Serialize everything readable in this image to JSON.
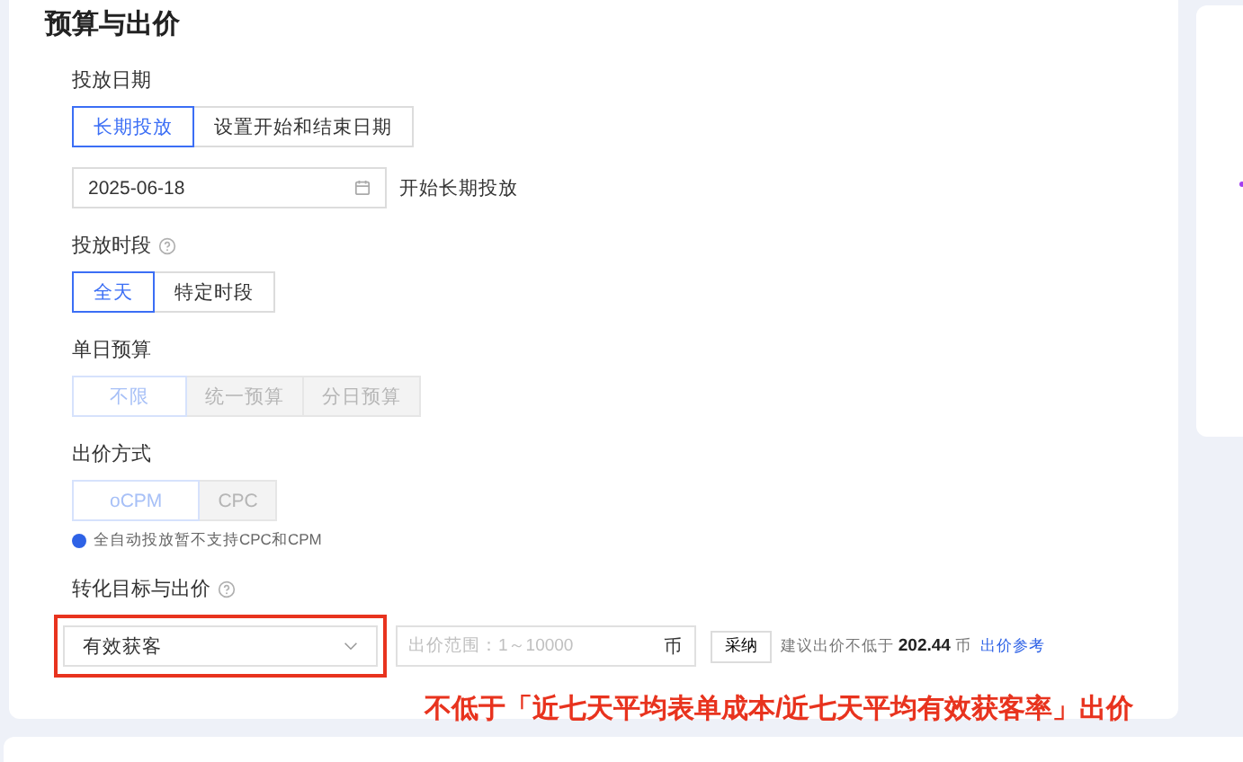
{
  "section": {
    "title": "预算与出价"
  },
  "fields": [
    {
      "kind": "segments",
      "label": "投放日期",
      "help": false,
      "disabled": false,
      "options": [
        {
          "label": "长期投放",
          "selected": true
        },
        {
          "label": "设置开始和结束日期",
          "selected": false
        }
      ]
    },
    {
      "kind": "date",
      "value": "2025-06-18",
      "after": "开始长期投放"
    },
    {
      "kind": "segments",
      "label": "投放时段",
      "help": true,
      "disabled": false,
      "options": [
        {
          "label": "全天",
          "selected": true
        },
        {
          "label": "特定时段",
          "selected": false
        }
      ]
    },
    {
      "kind": "segments",
      "label": "单日预算",
      "help": false,
      "disabled": true,
      "options": [
        {
          "label": "不限",
          "selected": true
        },
        {
          "label": "统一预算",
          "selected": false
        },
        {
          "label": "分日预算",
          "selected": false
        }
      ]
    },
    {
      "kind": "segments",
      "label": "出价方式",
      "help": false,
      "disabled": true,
      "options": [
        {
          "label": "oCPM",
          "selected": true
        },
        {
          "label": "CPC",
          "selected": false
        }
      ],
      "note": "全自动投放暂不支持CPC和CPM"
    },
    {
      "kind": "bid",
      "label": "转化目标与出价",
      "help": true,
      "goal": "有效获客",
      "placeholder": "出价范围：1～10000",
      "unit": "币",
      "adopt": "采纳",
      "suggest": "建议出价不低于 **202.44** 币",
      "link": "出价参考"
    }
  ],
  "annotation": "不低于「近七天平均表单成本/近七天平均有效获客率」出价"
}
